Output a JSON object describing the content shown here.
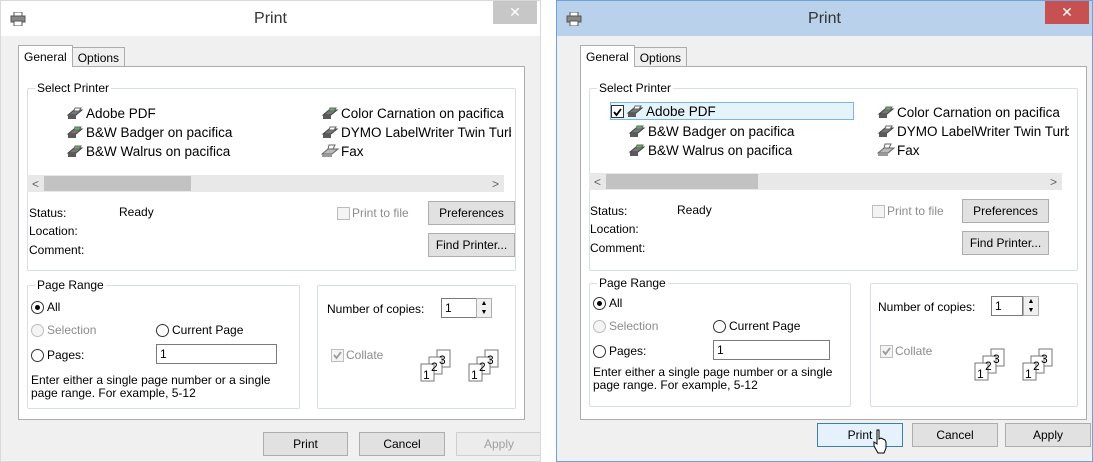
{
  "dialogs": [
    {
      "title": "Print",
      "close_label": "✕",
      "tabs": [
        "General",
        "Options"
      ],
      "select_printer": {
        "legend": "Select Printer",
        "printers": [
          "Adobe PDF",
          "B&W Badger on pacifica",
          "B&W Walrus on pacifica",
          "Color Carnation on pacifica",
          "DYMO LabelWriter Twin Turbı",
          "Fax"
        ],
        "selected_printer": ""
      },
      "scroll_left": "<",
      "scroll_right": ">",
      "status_label": "Status:",
      "status_value": "Ready",
      "location_label": "Location:",
      "comment_label": "Comment:",
      "print_to_file": "Print to file",
      "preferences": "Preferences",
      "find_printer": "Find Printer...",
      "page_range": {
        "legend": "Page Range",
        "all": "All",
        "selection": "Selection",
        "current_page": "Current Page",
        "pages": "Pages:",
        "pages_value": "1",
        "hint_line1": "Enter either a single page number or a single",
        "hint_line2": "page range.  For example, 5-12"
      },
      "copies_label": "Number of copies:",
      "copies_value": "1",
      "collate": "Collate",
      "collate_digits": [
        "1",
        "2",
        "3"
      ],
      "buttons": {
        "print": "Print",
        "cancel": "Cancel",
        "apply": "Apply"
      }
    },
    {
      "title": "Print",
      "close_label": "✕",
      "tabs": [
        "General",
        "Options"
      ],
      "select_printer": {
        "legend": "Select Printer",
        "printers": [
          "Adobe PDF",
          "B&W Badger on pacifica",
          "B&W Walrus on pacifica",
          "Color Carnation on pacifica",
          "DYMO LabelWriter Twin Turbı",
          "Fax"
        ],
        "selected_printer": "Adobe PDF"
      },
      "scroll_left": "<",
      "scroll_right": ">",
      "status_label": "Status:",
      "status_value": "Ready",
      "location_label": "Location:",
      "comment_label": "Comment:",
      "print_to_file": "Print to file",
      "preferences": "Preferences",
      "find_printer": "Find Printer...",
      "page_range": {
        "legend": "Page Range",
        "all": "All",
        "selection": "Selection",
        "current_page": "Current Page",
        "pages": "Pages:",
        "pages_value": "1",
        "hint_line1": "Enter either a single page number or a single",
        "hint_line2": "page range.  For example, 5-12"
      },
      "copies_label": "Number of copies:",
      "copies_value": "1",
      "collate": "Collate",
      "collate_digits": [
        "1",
        "2",
        "3"
      ],
      "buttons": {
        "print": "Print",
        "cancel": "Cancel",
        "apply": "Apply"
      }
    }
  ],
  "colors": {
    "dialog_bg": "#f0f0f0",
    "active_titlebar": "#b9d1ea",
    "close_active": "#c75050",
    "close_inactive": "#c7c7c7",
    "selection_bg": "#e5f3fb",
    "selection_border": "#7eb4ea"
  },
  "icons": {
    "printer": "printer-icon",
    "fax": "fax-icon",
    "spin_up": "spin-up-icon",
    "spin_down": "spin-down-icon",
    "cursor": "mouse-pointer-icon"
  }
}
